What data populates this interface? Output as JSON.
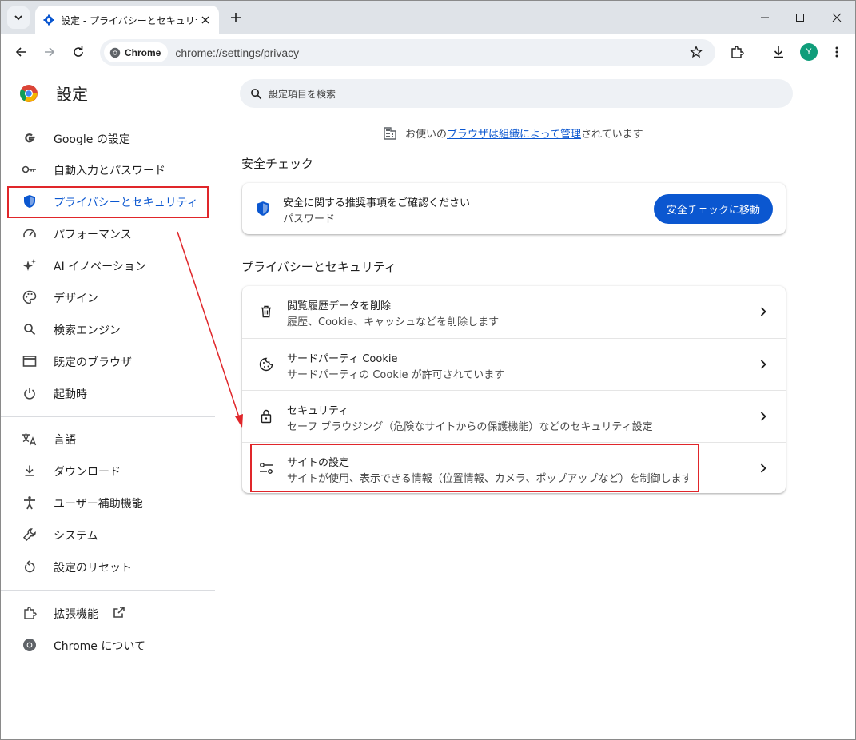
{
  "tab": {
    "title": "設定 - プライバシーとセキュリティ"
  },
  "toolbar": {
    "chip_label": "Chrome",
    "url": "chrome://settings/privacy",
    "avatar_letter": "Y"
  },
  "sidebar": {
    "brand": "設定",
    "items": [
      {
        "label": "Google の設定",
        "icon": "google-icon"
      },
      {
        "label": "自動入力とパスワード",
        "icon": "key-icon"
      },
      {
        "label": "プライバシーとセキュリティ",
        "icon": "shield-icon",
        "active": true
      },
      {
        "label": "パフォーマンス",
        "icon": "speedometer-icon"
      },
      {
        "label": "AI イノベーション",
        "icon": "sparkle-icon"
      },
      {
        "label": "デザイン",
        "icon": "palette-icon"
      },
      {
        "label": "検索エンジン",
        "icon": "search-icon"
      },
      {
        "label": "既定のブラウザ",
        "icon": "browser-window-icon"
      },
      {
        "label": "起動時",
        "icon": "power-icon"
      },
      {
        "label": "言語",
        "icon": "translate-icon"
      },
      {
        "label": "ダウンロード",
        "icon": "download-icon"
      },
      {
        "label": "ユーザー補助機能",
        "icon": "accessibility-icon"
      },
      {
        "label": "システム",
        "icon": "wrench-icon"
      },
      {
        "label": "設定のリセット",
        "icon": "reset-icon"
      },
      {
        "label": "拡張機能",
        "icon": "puzzle-icon"
      },
      {
        "label": "Chrome について",
        "icon": "chrome-icon"
      }
    ]
  },
  "main": {
    "search_placeholder": "設定項目を検索",
    "managed": {
      "prefix": "お使いの",
      "link": "ブラウザは組織によって管理",
      "suffix": "されています"
    },
    "safety": {
      "section_title": "安全チェック",
      "title": "安全に関する推奨事項をご確認ください",
      "subtitle": "パスワード",
      "button": "安全チェックに移動"
    },
    "privacy": {
      "section_title": "プライバシーとセキュリティ",
      "rows": [
        {
          "title": "閲覧履歴データを削除",
          "subtitle": "履歴、Cookie、キャッシュなどを削除します",
          "icon": "trash-icon"
        },
        {
          "title": "サードパーティ Cookie",
          "subtitle": "サードパーティの Cookie が許可されています",
          "icon": "cookie-icon"
        },
        {
          "title": "セキュリティ",
          "subtitle": "セーフ ブラウジング（危険なサイトからの保護機能）などのセキュリティ設定",
          "icon": "lock-icon"
        },
        {
          "title": "サイトの設定",
          "subtitle": "サイトが使用、表示できる情報（位置情報、カメラ、ポップアップなど）を制御します",
          "icon": "tune-icon"
        }
      ]
    }
  },
  "colors": {
    "accent": "#0b57d0",
    "annotation": "#e0262a"
  }
}
